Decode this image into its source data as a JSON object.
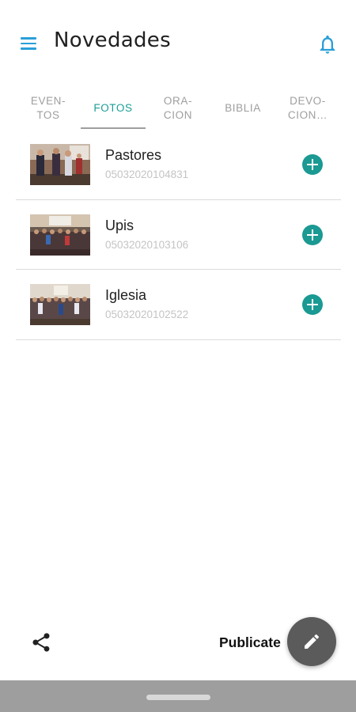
{
  "app": {
    "title": "Novedades"
  },
  "icons": {
    "menu": "menu-icon",
    "notifications": "bell-icon",
    "add": "plus-circle-icon",
    "share": "share-icon",
    "edit": "pencil-icon"
  },
  "colors": {
    "accent_blue": "#2a9fd8",
    "accent_teal": "#1a9e96",
    "tab_inactive": "#9e9e9e",
    "fab": "#5b5b5b"
  },
  "tabs": [
    {
      "label_line1": "EVEN-",
      "label_line2": "TOS"
    },
    {
      "label_line1": "FOTOS",
      "label_line2": ""
    },
    {
      "label_line1": "ORA-",
      "label_line2": "CION"
    },
    {
      "label_line1": "BIBLIA",
      "label_line2": ""
    },
    {
      "label_line1": "DEVO-",
      "label_line2": "CION…"
    }
  ],
  "active_tab": "FOTOS",
  "photos": [
    {
      "title": "Pastores",
      "id": "05032020104831"
    },
    {
      "title": "Upis",
      "id": "05032020103106"
    },
    {
      "title": "Iglesia",
      "id": "05032020102522"
    }
  ],
  "bottom": {
    "publicate_label": "Publicate"
  }
}
